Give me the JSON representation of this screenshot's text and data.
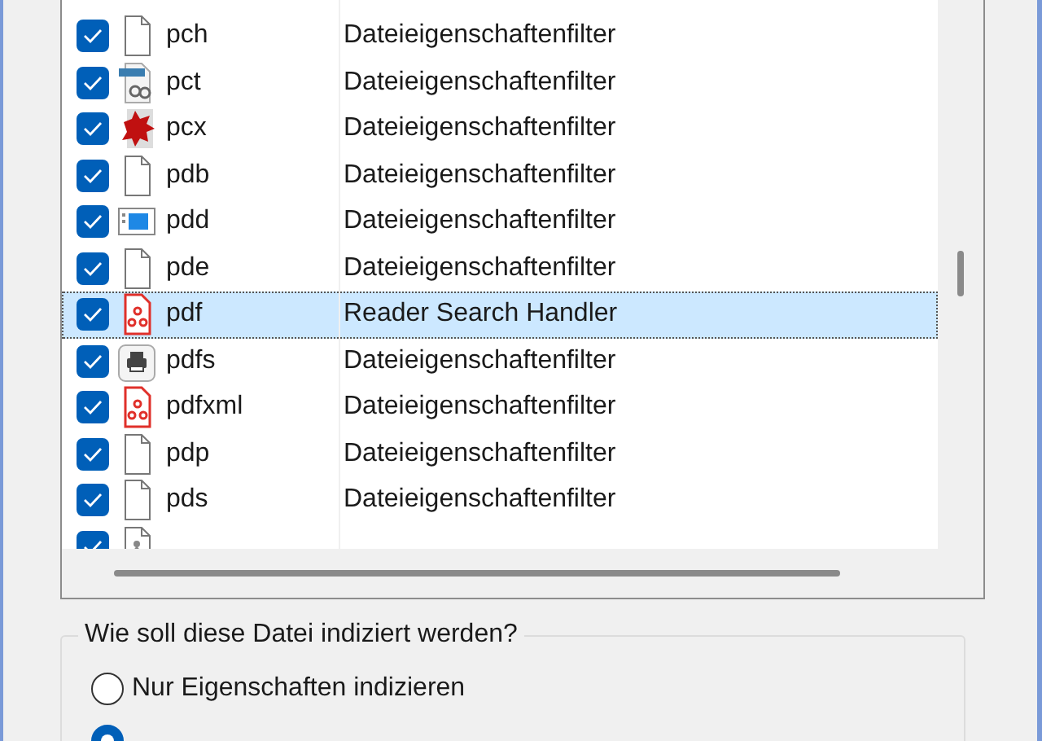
{
  "file_types": {
    "rows": [
      {
        "extension": "pch",
        "filter": "Dateieigenschaftenfilter",
        "checked": true,
        "selected": false,
        "kind": "document"
      },
      {
        "extension": "pct",
        "filter": "Dateieigenschaftenfilter",
        "checked": true,
        "selected": false,
        "kind": "image"
      },
      {
        "extension": "pcx",
        "filter": "Dateieigenschaftenfilter",
        "checked": true,
        "selected": false,
        "kind": "splat"
      },
      {
        "extension": "pdb",
        "filter": "Dateieigenschaftenfilter",
        "checked": true,
        "selected": false,
        "kind": "document"
      },
      {
        "extension": "pdd",
        "filter": "Dateieigenschaftenfilter",
        "checked": true,
        "selected": false,
        "kind": "window"
      },
      {
        "extension": "pde",
        "filter": "Dateieigenschaftenfilter",
        "checked": true,
        "selected": false,
        "kind": "document"
      },
      {
        "extension": "pdf",
        "filter": "Reader Search Handler",
        "checked": true,
        "selected": true,
        "kind": "pdf"
      },
      {
        "extension": "pdfs",
        "filter": "Dateieigenschaftenfilter",
        "checked": true,
        "selected": false,
        "kind": "printer"
      },
      {
        "extension": "pdfxml",
        "filter": "Dateieigenschaftenfilter",
        "checked": true,
        "selected": false,
        "kind": "pdf"
      },
      {
        "extension": "pdp",
        "filter": "Dateieigenschaftenfilter",
        "checked": true,
        "selected": false,
        "kind": "document"
      },
      {
        "extension": "pds",
        "filter": "Dateieigenschaftenfilter",
        "checked": true,
        "selected": false,
        "kind": "document"
      },
      {
        "checked": true,
        "selected": false,
        "kind": "person"
      }
    ]
  },
  "index_mode": {
    "title": "Wie soll diese Datei indiziert werden?",
    "options": [
      {
        "label": "Nur Eigenschaften indizieren",
        "selected": false
      },
      {
        "selected": true
      }
    ]
  }
}
